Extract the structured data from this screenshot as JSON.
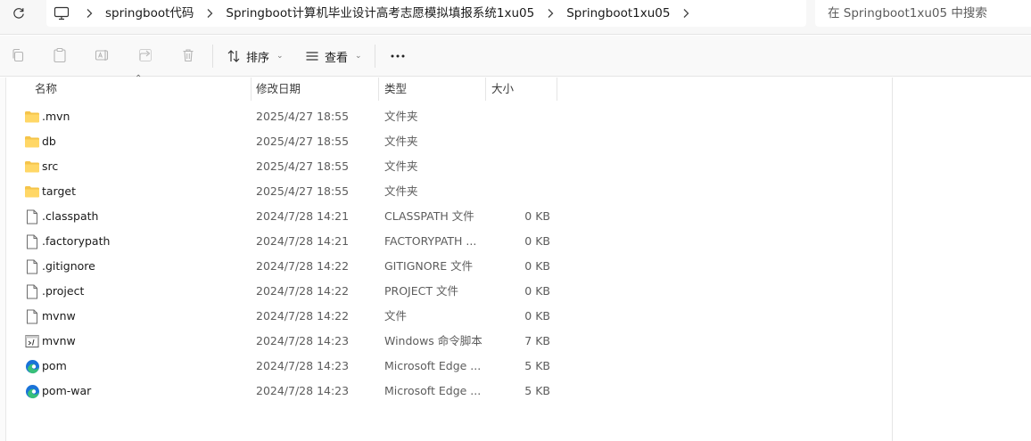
{
  "address_bar": {
    "refresh_icon": "refresh-icon",
    "pc_icon": "this-pc-icon",
    "breadcrumb": [
      "springboot代码",
      "Springboot计算机毕业设计高考志愿模拟填报系统1xu05",
      "Springboot1xu05"
    ],
    "search_placeholder": "在 Springboot1xu05 中搜索"
  },
  "toolbar": {
    "icons": [
      "copy-icon",
      "paste-icon",
      "rename-icon",
      "share-icon",
      "delete-icon"
    ],
    "sort_label": "排序",
    "view_label": "查看",
    "more_label": "..."
  },
  "columns": {
    "name": "名称",
    "modified": "修改日期",
    "type": "类型",
    "size": "大小"
  },
  "files": [
    {
      "name": ".mvn",
      "modified": "2025/4/27 18:55",
      "type": "文件夹",
      "size": "",
      "icon": "folder-icon"
    },
    {
      "name": "db",
      "modified": "2025/4/27 18:55",
      "type": "文件夹",
      "size": "",
      "icon": "folder-icon"
    },
    {
      "name": "src",
      "modified": "2025/4/27 18:55",
      "type": "文件夹",
      "size": "",
      "icon": "folder-icon"
    },
    {
      "name": "target",
      "modified": "2025/4/27 18:55",
      "type": "文件夹",
      "size": "",
      "icon": "folder-icon"
    },
    {
      "name": ".classpath",
      "modified": "2024/7/28 14:21",
      "type": "CLASSPATH 文件",
      "size": "0 KB",
      "icon": "file-icon"
    },
    {
      "name": ".factorypath",
      "modified": "2024/7/28 14:21",
      "type": "FACTORYPATH ...",
      "size": "0 KB",
      "icon": "file-icon"
    },
    {
      "name": ".gitignore",
      "modified": "2024/7/28 14:22",
      "type": "GITIGNORE 文件",
      "size": "0 KB",
      "icon": "file-icon"
    },
    {
      "name": ".project",
      "modified": "2024/7/28 14:22",
      "type": "PROJECT 文件",
      "size": "0 KB",
      "icon": "file-icon"
    },
    {
      "name": "mvnw",
      "modified": "2024/7/28 14:22",
      "type": "文件",
      "size": "0 KB",
      "icon": "file-icon"
    },
    {
      "name": "mvnw",
      "modified": "2024/7/28 14:23",
      "type": "Windows 命令脚本",
      "size": "7 KB",
      "icon": "cmd-script-icon"
    },
    {
      "name": "pom",
      "modified": "2024/7/28 14:23",
      "type": "Microsoft Edge ...",
      "size": "5 KB",
      "icon": "edge-icon"
    },
    {
      "name": "pom-war",
      "modified": "2024/7/28 14:23",
      "type": "Microsoft Edge ...",
      "size": "5 KB",
      "icon": "edge-icon"
    }
  ],
  "colors": {
    "folder": "#f5c44a",
    "edge_blue": "#1a73d9",
    "edge_green": "#39c07a"
  }
}
